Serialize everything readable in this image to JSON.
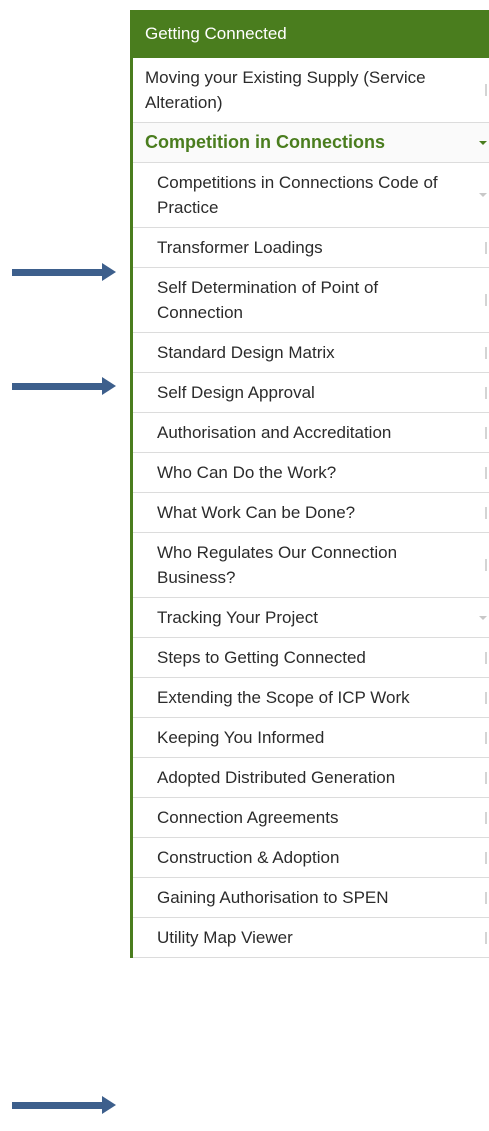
{
  "menu": {
    "header": "Getting Connected",
    "items": [
      {
        "label": "Moving your Existing Supply (Service Alteration)",
        "level": "top",
        "marker": "bar"
      },
      {
        "label": "Competition in Connections",
        "level": "section",
        "marker": "down"
      },
      {
        "label": "Competitions in Connections Code of Practice",
        "level": "sub",
        "marker": "down"
      },
      {
        "label": "Transformer Loadings",
        "level": "sub",
        "marker": "bar"
      },
      {
        "label": "Self Determination of Point of Connection",
        "level": "sub",
        "marker": "bar"
      },
      {
        "label": "Standard Design Matrix",
        "level": "sub",
        "marker": "bar"
      },
      {
        "label": "Self Design Approval",
        "level": "sub",
        "marker": "bar"
      },
      {
        "label": "Authorisation and Accreditation",
        "level": "sub",
        "marker": "bar"
      },
      {
        "label": "Who Can Do the Work?",
        "level": "sub",
        "marker": "bar"
      },
      {
        "label": "What Work Can be Done?",
        "level": "sub",
        "marker": "bar"
      },
      {
        "label": "Who Regulates Our Connection Business?",
        "level": "sub",
        "marker": "bar"
      },
      {
        "label": "Tracking Your Project",
        "level": "sub",
        "marker": "down"
      },
      {
        "label": "Steps to Getting Connected",
        "level": "sub",
        "marker": "bar"
      },
      {
        "label": "Extending the Scope of ICP Work",
        "level": "sub",
        "marker": "bar"
      },
      {
        "label": "Keeping You Informed",
        "level": "sub",
        "marker": "bar"
      },
      {
        "label": "Adopted Distributed Generation",
        "level": "sub",
        "marker": "bar"
      },
      {
        "label": "Connection Agreements",
        "level": "sub",
        "marker": "bar"
      },
      {
        "label": "Construction & Adoption",
        "level": "sub",
        "marker": "bar"
      },
      {
        "label": "Gaining Authorisation to SPEN",
        "level": "sub",
        "marker": "bar"
      },
      {
        "label": "Utility Map Viewer",
        "level": "sub",
        "marker": "bar"
      }
    ]
  },
  "colors": {
    "brand_green": "#4a7d1e",
    "arrow_blue": "#3d5f8c"
  }
}
